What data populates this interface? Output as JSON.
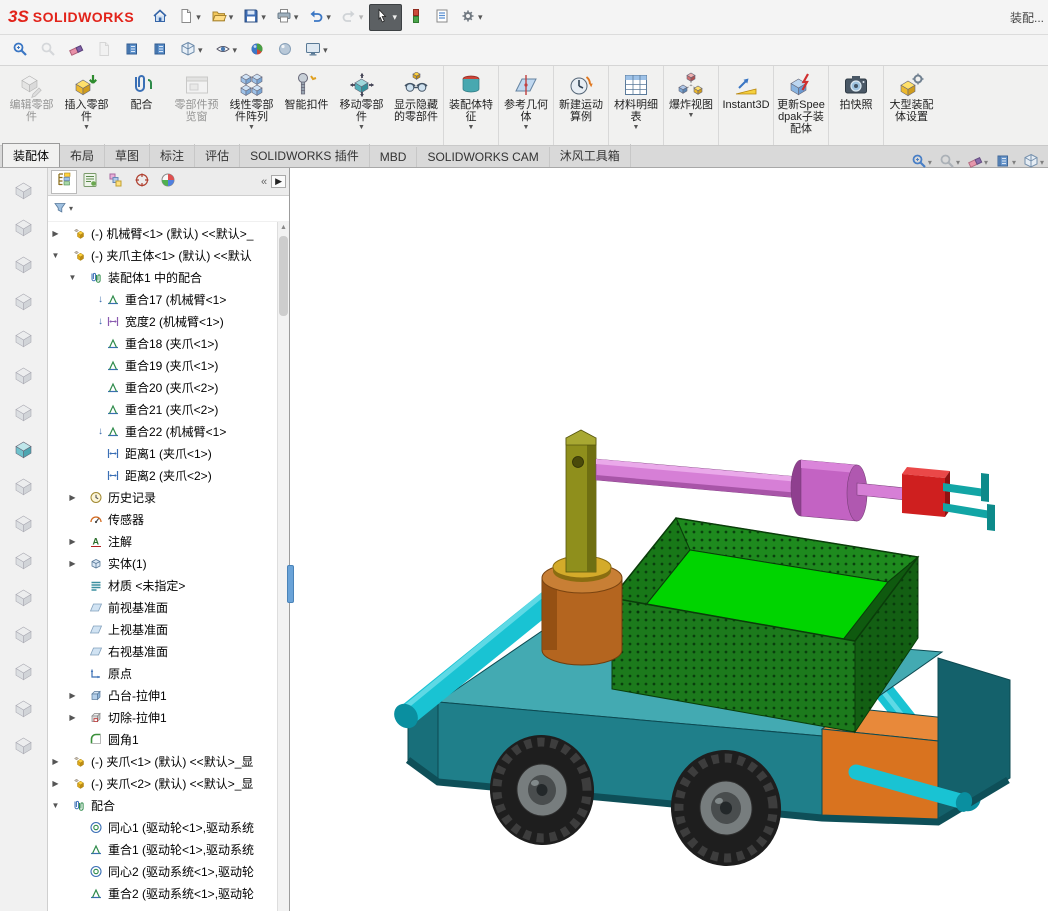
{
  "titlebar": {
    "logo_mark": "3S",
    "logo_text": "SOLIDWORKS",
    "window_title": "装配...",
    "buttons": [
      {
        "name": "home-button",
        "icon": "home"
      },
      {
        "name": "new-document-button",
        "icon": "new-doc",
        "dropdown": true
      },
      {
        "name": "open-button",
        "icon": "open",
        "dropdown": true
      },
      {
        "name": "save-button",
        "icon": "save",
        "dropdown": true
      },
      {
        "name": "print-button",
        "icon": "print",
        "dropdown": true
      },
      {
        "name": "undo-button",
        "icon": "undo",
        "dropdown": true
      },
      {
        "name": "redo-button",
        "icon": "redo",
        "dropdown": true,
        "disabled": true
      },
      {
        "name": "select-tool-button",
        "icon": "select-cursor",
        "dropdown": true,
        "pressed": true
      },
      {
        "name": "rebuild-button",
        "icon": "rebuild"
      },
      {
        "name": "file-properties-button",
        "icon": "file-props"
      },
      {
        "name": "options-button",
        "icon": "gear",
        "dropdown": true
      }
    ]
  },
  "toolbar2": {
    "buttons": [
      {
        "name": "selection-filter-button",
        "icon": "sel-filter"
      },
      {
        "name": "filter-toggle-button",
        "icon": "magnifier-gray",
        "disabled": true
      },
      {
        "name": "clear-selections-button",
        "icon": "eraser"
      },
      {
        "name": "filter-document-button",
        "icon": "doc-gray",
        "disabled": true
      },
      {
        "name": "filter-edges-button",
        "icon": "book"
      },
      {
        "name": "filter-faces-button",
        "icon": "book"
      },
      {
        "name": "view-orientation-button",
        "icon": "view-cube",
        "dropdown": true
      },
      {
        "name": "display-style-button",
        "icon": "eye",
        "dropdown": true
      },
      {
        "name": "edit-appearance-button",
        "icon": "sphere-rgb"
      },
      {
        "name": "apply-scene-button",
        "icon": "sphere"
      },
      {
        "name": "view-settings-button",
        "icon": "monitor",
        "dropdown": true
      }
    ]
  },
  "ribbon": {
    "buttons": [
      {
        "name": "edit-component-button",
        "label": "编辑零部件",
        "icon": "r-edit",
        "disabled": true
      },
      {
        "name": "insert-components-button",
        "label": "插入零部件",
        "icon": "r-insert",
        "dropdown": true
      },
      {
        "name": "mate-button",
        "label": "配合",
        "icon": "r-mate"
      },
      {
        "name": "component-preview-button",
        "label": "零部件预览窗",
        "icon": "r-preview",
        "disabled": true
      },
      {
        "name": "linear-pattern-button",
        "label": "线性零部件阵列",
        "icon": "r-pattern",
        "dropdown": true
      },
      {
        "name": "smart-fasteners-button",
        "label": "智能扣件",
        "icon": "r-fastener"
      },
      {
        "name": "move-component-button",
        "label": "移动零部件",
        "icon": "r-move",
        "dropdown": true
      },
      {
        "name": "show-hidden-button",
        "label": "显示隐藏的零部件",
        "icon": "r-showhide",
        "sep": true
      },
      {
        "name": "assembly-features-button",
        "label": "装配体特征",
        "icon": "r-feat",
        "dropdown": true,
        "sep": true
      },
      {
        "name": "reference-geometry-button",
        "label": "参考几何体",
        "icon": "r-refgeo",
        "dropdown": true,
        "sep": true
      },
      {
        "name": "motion-study-button",
        "label": "新建运动算例",
        "icon": "r-motion",
        "sep": true
      },
      {
        "name": "bom-button",
        "label": "材料明细表",
        "icon": "r-bom",
        "dropdown": true,
        "sep": true
      },
      {
        "name": "exploded-view-button",
        "label": "爆炸视图",
        "icon": "r-explode",
        "dropdown": true,
        "sep": true
      },
      {
        "name": "instant3d-button",
        "label": "Instant3D",
        "icon": "r-instant",
        "sep": true
      },
      {
        "name": "update-speedpak-button",
        "label": "更新Speedpak子装配体",
        "icon": "r-speedpak",
        "sep": true
      },
      {
        "name": "snapshot-button",
        "label": "拍快照",
        "icon": "r-snapshot",
        "sep": true
      },
      {
        "name": "large-assembly-button",
        "label": "大型装配体设置",
        "icon": "r-largeasm"
      }
    ]
  },
  "tabs": {
    "items": [
      {
        "name": "tab-assembly",
        "label": "装配体",
        "active": true
      },
      {
        "name": "tab-layout",
        "label": "布局"
      },
      {
        "name": "tab-sketch",
        "label": "草图"
      },
      {
        "name": "tab-annotation",
        "label": "标注"
      },
      {
        "name": "tab-evaluate",
        "label": "评估"
      },
      {
        "name": "tab-addins",
        "label": "SOLIDWORKS 插件"
      },
      {
        "name": "tab-mbd",
        "label": "MBD"
      },
      {
        "name": "tab-solidworks-cam",
        "label": "SOLIDWORKS CAM"
      },
      {
        "name": "tab-mufeng-toolbox",
        "label": "沐风工具箱"
      }
    ]
  },
  "panel": {
    "tabs": [
      {
        "name": "featuremanager-tab",
        "icon": "ftree",
        "active": true
      },
      {
        "name": "propertymanager-tab",
        "icon": "pm"
      },
      {
        "name": "configurationmanager-tab",
        "icon": "cfg"
      },
      {
        "name": "dimxpertmanager-tab",
        "icon": "dimx"
      },
      {
        "name": "displaymanager-tab",
        "icon": "disp"
      }
    ],
    "collapse_label": "«",
    "expand_label": "▶"
  },
  "tree": {
    "items": [
      {
        "level": 0,
        "expand": "closed",
        "icon": "assembly",
        "label": "(-) 机械臂<1> (默认) <<默认>_"
      },
      {
        "level": 0,
        "expand": "open",
        "icon": "assembly",
        "label": "(-) 夹爪主体<1> (默认) <<默认"
      },
      {
        "level": 1,
        "expand": "open",
        "icon": "mate-group",
        "label": "装配体1 中的配合"
      },
      {
        "level": 2,
        "icon": "coincident",
        "badge": true,
        "label": "重合17 (机械臂<1>"
      },
      {
        "level": 2,
        "icon": "width",
        "badge": true,
        "label": "宽度2 (机械臂<1>)"
      },
      {
        "level": 2,
        "icon": "coincident",
        "label": "重合18 (夹爪<1>)"
      },
      {
        "level": 2,
        "icon": "coincident",
        "label": "重合19 (夹爪<1>)"
      },
      {
        "level": 2,
        "icon": "coincident",
        "label": "重合20 (夹爪<2>)"
      },
      {
        "level": 2,
        "icon": "coincident",
        "label": "重合21 (夹爪<2>)"
      },
      {
        "level": 2,
        "icon": "coincident",
        "badge": true,
        "label": "重合22 (机械臂<1>"
      },
      {
        "level": 2,
        "icon": "distance",
        "label": "距离1 (夹爪<1>)"
      },
      {
        "level": 2,
        "icon": "distance",
        "label": "距离2 (夹爪<2>)"
      },
      {
        "level": 1,
        "expand": "closed",
        "icon": "history",
        "label": "历史记录"
      },
      {
        "level": 1,
        "icon": "sensor",
        "label": "传感器"
      },
      {
        "level": 1,
        "expand": "closed",
        "icon": "annotations",
        "label": "注解"
      },
      {
        "level": 1,
        "expand": "closed",
        "icon": "bodies",
        "label": "实体(1)"
      },
      {
        "level": 1,
        "icon": "material",
        "label": "材质 <未指定>"
      },
      {
        "level": 1,
        "icon": "plane",
        "label": "前视基准面"
      },
      {
        "level": 1,
        "icon": "plane",
        "label": "上视基准面"
      },
      {
        "level": 1,
        "icon": "plane",
        "label": "右视基准面"
      },
      {
        "level": 1,
        "icon": "origin",
        "label": "原点"
      },
      {
        "level": 1,
        "expand": "closed",
        "icon": "boss",
        "label": "凸台-拉伸1"
      },
      {
        "level": 1,
        "expand": "closed",
        "icon": "cut",
        "label": "切除-拉伸1"
      },
      {
        "level": 1,
        "icon": "fillet",
        "label": "圆角1"
      },
      {
        "level": 0,
        "expand": "closed",
        "icon": "assembly",
        "label": "(-) 夹爪<1> (默认) <<默认>_显"
      },
      {
        "level": 0,
        "expand": "closed",
        "icon": "assembly",
        "label": "(-) 夹爪<2> (默认) <<默认>_显"
      },
      {
        "level": 0,
        "expand": "open",
        "icon": "mate-group",
        "label": "配合"
      },
      {
        "level": 1,
        "icon": "concentric",
        "label": "同心1 (驱动轮<1>,驱动系统"
      },
      {
        "level": 1,
        "icon": "coincident",
        "label": "重合1 (驱动轮<1>,驱动系统"
      },
      {
        "level": 1,
        "icon": "concentric",
        "label": "同心2 (驱动系统<1>,驱动轮"
      },
      {
        "level": 1,
        "icon": "coincident",
        "label": "重合2 (驱动系统<1>,驱动轮"
      }
    ]
  },
  "left_toolbar": {
    "buttons": [
      {
        "name": "cad-tool-1",
        "icon": "gray-tool",
        "disabled": true
      },
      {
        "name": "cad-tool-2",
        "icon": "gray-tool",
        "disabled": true
      },
      {
        "name": "cad-tool-3",
        "icon": "gray-tool",
        "disabled": true
      },
      {
        "name": "cad-tool-4",
        "icon": "gray-tool",
        "disabled": true
      },
      {
        "name": "cad-tool-5",
        "icon": "gray-tool",
        "disabled": true
      },
      {
        "name": "cad-tool-6",
        "icon": "gray-tool",
        "disabled": true
      },
      {
        "name": "cad-tool-7",
        "icon": "gray-tool",
        "disabled": true
      },
      {
        "name": "cad-tool-8",
        "icon": "teal-tool"
      },
      {
        "name": "cad-tool-9",
        "icon": "gray-tool",
        "disabled": true
      },
      {
        "name": "cad-tool-10",
        "icon": "gray-tool",
        "disabled": true
      },
      {
        "name": "cad-tool-11",
        "icon": "gray-tool",
        "disabled": true
      },
      {
        "name": "cad-tool-12",
        "icon": "gray-tool",
        "disabled": true
      },
      {
        "name": "cad-tool-13",
        "icon": "gray-tool",
        "disabled": true
      },
      {
        "name": "cad-tool-14",
        "icon": "gray-tool",
        "disabled": true
      },
      {
        "name": "cad-tool-15",
        "icon": "gray-tool",
        "disabled": true
      },
      {
        "name": "cad-tool-16",
        "icon": "gray-tool",
        "disabled": true
      }
    ]
  },
  "headsup": {
    "buttons": [
      {
        "name": "zoom-fit-button",
        "icon": "sel-filter"
      },
      {
        "name": "zoom-area-button",
        "icon": "magnifier-gray"
      },
      {
        "name": "clear-view-button",
        "icon": "eraser"
      },
      {
        "name": "filter-display-button",
        "icon": "book"
      },
      {
        "name": "view-orientation-cube-button",
        "icon": "view-cube"
      }
    ]
  },
  "model": {
    "body_top": "#43aab2",
    "body_front": "#1f7f8a",
    "body_dark": "#14616b",
    "orange_panel": "#d9731f",
    "tube": "#19c3d3",
    "tire": "#1e1e1e",
    "hub": "#777d7e",
    "basket_front": "#1c7a1c",
    "basket_inner": "#1e8a1e",
    "basket_floor": "#00d400",
    "cylinder": "#b4651f",
    "cylinder_top": "#c87f35",
    "ring": "#d4ab2a",
    "post": "#8f8f1c",
    "arm": "#d67fd6",
    "arm_hub": "#c363c3",
    "end_block": "#cf1f1f",
    "gripper": "#12a5a5"
  }
}
